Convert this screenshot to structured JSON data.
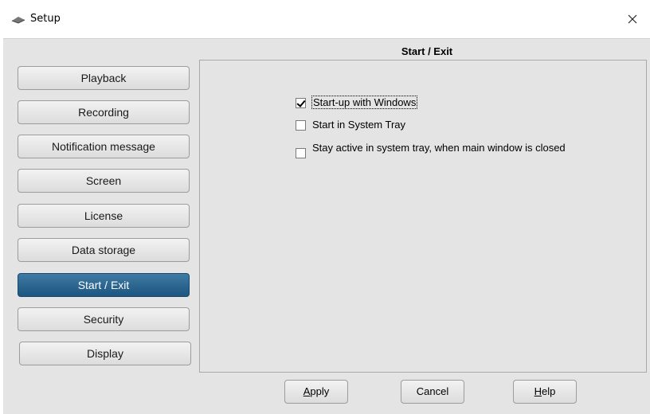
{
  "window": {
    "title": "Setup"
  },
  "sidebar": {
    "items": [
      {
        "label": "Playback"
      },
      {
        "label": "Recording"
      },
      {
        "label": "Notification message"
      },
      {
        "label": "Screen"
      },
      {
        "label": "License"
      },
      {
        "label": "Data storage"
      },
      {
        "label": "Start / Exit",
        "active": true
      },
      {
        "label": "Security"
      },
      {
        "label": "Display"
      }
    ]
  },
  "section": {
    "title": "Start / Exit"
  },
  "options": [
    {
      "label": "Start-up with Windows",
      "checked": true
    },
    {
      "label": "Start in System Tray",
      "checked": false
    },
    {
      "label": "Stay active in system tray, when main window is closed",
      "checked": false
    }
  ],
  "buttons": {
    "apply_first": "A",
    "apply_rest": "pply",
    "cancel": "Cancel",
    "help_first": "H",
    "help_rest": "elp"
  },
  "colors": {
    "active_nav": "#2a6690",
    "client_bg": "#e4e4e4"
  }
}
